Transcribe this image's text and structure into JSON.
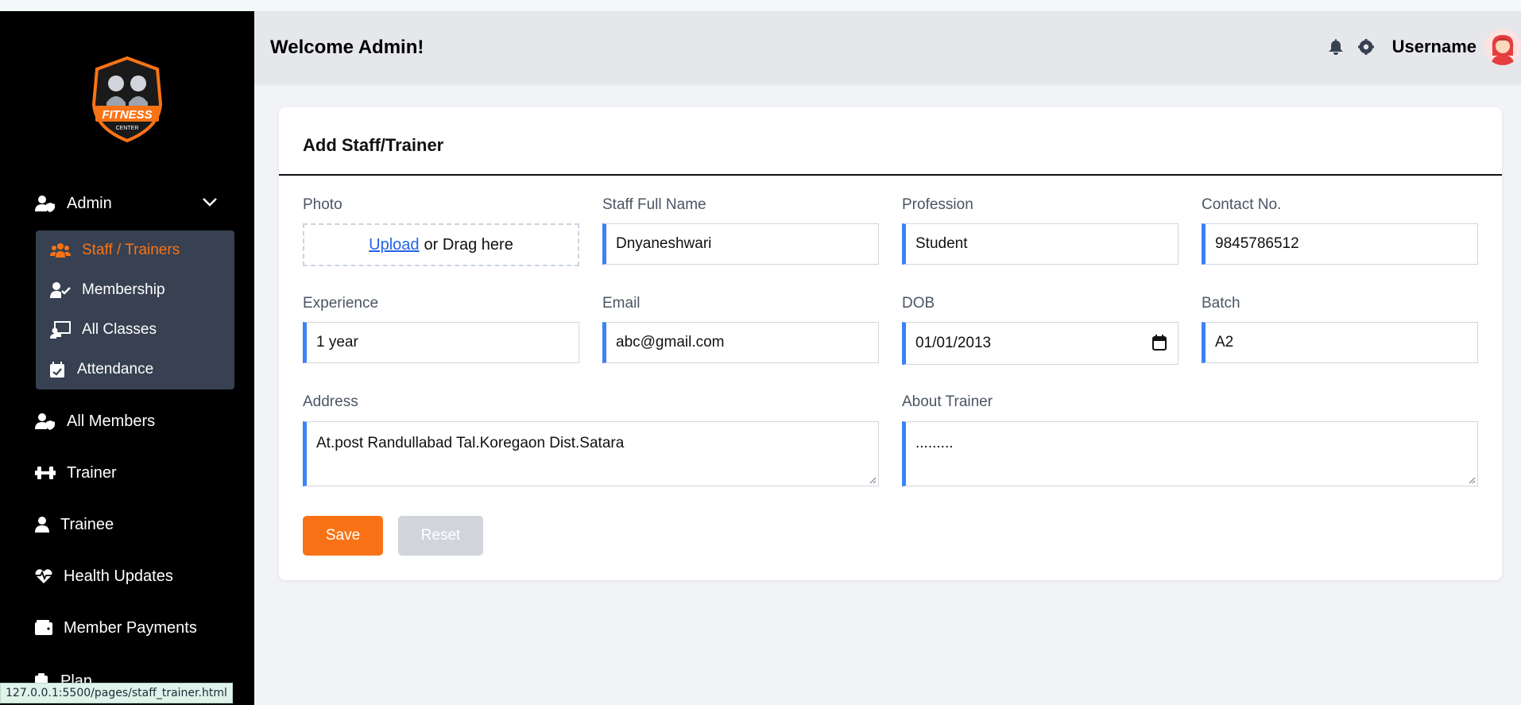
{
  "sidebar": {
    "logo_text": "FITNESS",
    "logo_subtext": "CENTER",
    "admin_label": "Admin",
    "submenu": [
      {
        "label": "Staff / Trainers",
        "icon": "users-icon",
        "active": true
      },
      {
        "label": "Membership",
        "icon": "user-check-icon",
        "active": false
      },
      {
        "label": "All Classes",
        "icon": "chalkboard-teacher-icon",
        "active": false
      },
      {
        "label": "Attendance",
        "icon": "calendar-check-icon",
        "active": false
      }
    ],
    "items": [
      {
        "label": "All Members",
        "icon": "user-shield-icon"
      },
      {
        "label": "Trainer",
        "icon": "dumbbell-icon"
      },
      {
        "label": "Trainee",
        "icon": "user-icon"
      },
      {
        "label": "Health Updates",
        "icon": "heart-pulse-icon"
      },
      {
        "label": "Member Payments",
        "icon": "wallet-icon"
      },
      {
        "label": "Plan",
        "icon": "clipboard-icon"
      }
    ]
  },
  "status_url": "127.0.0.1:5500/pages/staff_trainer.html",
  "header": {
    "welcome": "Welcome Admin!",
    "username": "Username"
  },
  "form": {
    "title": "Add Staff/Trainer",
    "photo_label": "Photo",
    "upload_link": "Upload",
    "upload_text": "or Drag here",
    "name_label": "Staff Full Name",
    "name_value": "Dnyaneshwari",
    "profession_label": "Profession",
    "profession_value": "Student",
    "contact_label": "Contact No.",
    "contact_value": "9845786512",
    "experience_label": "Experience",
    "experience_value": "1 year",
    "email_label": "Email",
    "email_value": "abc@gmail.com",
    "dob_label": "DOB",
    "dob_value": "01/01/2013",
    "batch_label": "Batch",
    "batch_value": "A2",
    "address_label": "Address",
    "address_value": "At.post Randullabad Tal.Koregaon Dist.Satara",
    "about_label": "About Trainer",
    "about_value": ".........",
    "save_label": "Save",
    "reset_label": "Reset"
  },
  "colors": {
    "accent": "#f97316",
    "field_border": "#3b82f6",
    "sidebar_bg": "#000000",
    "submenu_bg": "#374151"
  }
}
